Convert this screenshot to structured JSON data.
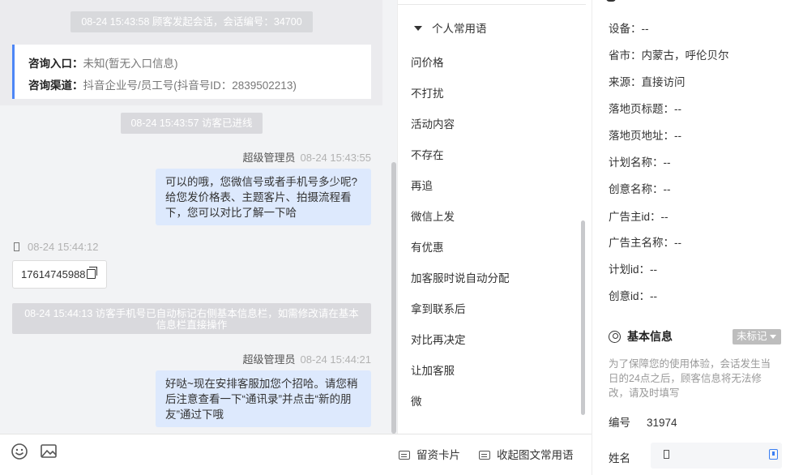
{
  "chat": {
    "session_start": "08-24 15:43:58 顾客发起会话，会话编号：34700",
    "entry_label": "咨询入口：",
    "entry_value": "未知(暂无入口信息)",
    "channel_label": "咨询渠道：",
    "channel_value": "抖音企业号/员工号(抖音号ID：2839502213)",
    "visitor_entered": "08-24 15:43:57 访客已进线",
    "msg1": {
      "sender": "超级管理员",
      "time": "08-24 15:43:55",
      "text": "可以的哦，您微信号或者手机号多少呢?给您发价格表、主题客片、拍摄流程看下，您可以对比了解一下哈"
    },
    "visitor_msg": {
      "time": "08-24 15:44:12",
      "text": "17614745988"
    },
    "auto_mark_notice": "08-24 15:44:13 访客手机号已自动标记右侧基本信息栏，如需修改请在基本信息栏直接操作",
    "msg2": {
      "sender": "超级管理员",
      "time": "08-24 15:44:21",
      "text": "好哒~现在安排客服加您个招哈。请您稍后注意查看一下“通讯录”并点击“新的朋友”通过下哦"
    }
  },
  "toolbar": {
    "emoji_icon": "smile-icon",
    "image_icon": "image-icon",
    "card_label": "留资卡片",
    "collapse_label": "收起图文常用语"
  },
  "phrases": {
    "header": "个人常用语",
    "items": [
      "问价格",
      "不打扰",
      "活动内容",
      "不存在",
      "再追",
      "微信上发",
      "有优惠",
      "加客服时说自动分配",
      "拿到联系后",
      "对比再决定",
      "让加客服",
      "微"
    ]
  },
  "info": {
    "fields": [
      {
        "label": "设备：",
        "value": "--"
      },
      {
        "label": "省市：",
        "value": "内蒙古，呼伦贝尔"
      },
      {
        "label": "来源：",
        "value": "直接访问"
      },
      {
        "label": "落地页标题：",
        "value": "--"
      },
      {
        "label": "落地页地址：",
        "value": "--"
      },
      {
        "label": "计划名称：",
        "value": "--"
      },
      {
        "label": "创意名称：",
        "value": "--"
      },
      {
        "label": "广告主id：",
        "value": "--"
      },
      {
        "label": "广告主名称：",
        "value": "--"
      },
      {
        "label": "计划id：",
        "value": "--"
      },
      {
        "label": "创意id：",
        "value": "--"
      }
    ],
    "basic_title": "基本信息",
    "tag_button": "未标记",
    "notice": "为了保障您的使用体验，会话发生当日的24点之后，顾客信息将无法修改，请及时填写",
    "id_label": "编号",
    "id_value": "31974",
    "name_label": "姓名"
  },
  "colors": {
    "accent": "#4d86f6",
    "bubble_agent": "#dde9fd",
    "system_notice": "#d9d9dd"
  }
}
